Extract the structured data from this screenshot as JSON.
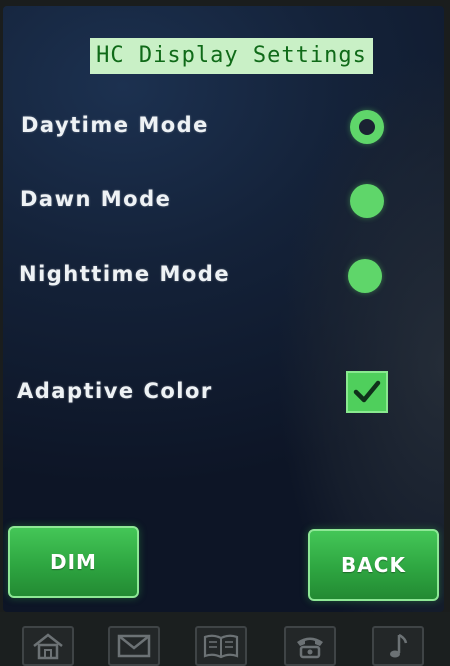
{
  "title": "HC Display Settings",
  "modes": [
    {
      "label": "Daytime Mode",
      "selected": true
    },
    {
      "label": "Dawn Mode",
      "selected": false
    },
    {
      "label": "Nighttime Mode",
      "selected": false
    }
  ],
  "adaptive_color": {
    "label": "Adaptive Color",
    "checked": true
  },
  "buttons": {
    "dim": "DIM",
    "back": "BACK"
  },
  "dock": [
    "home-icon",
    "mail-icon",
    "book-icon",
    "phone-icon",
    "music-icon"
  ],
  "colors": {
    "accent": "#5fd66a",
    "title_bg": "#c9f0c6",
    "title_text": "#0f6a18",
    "screen_bg": "#142239"
  }
}
